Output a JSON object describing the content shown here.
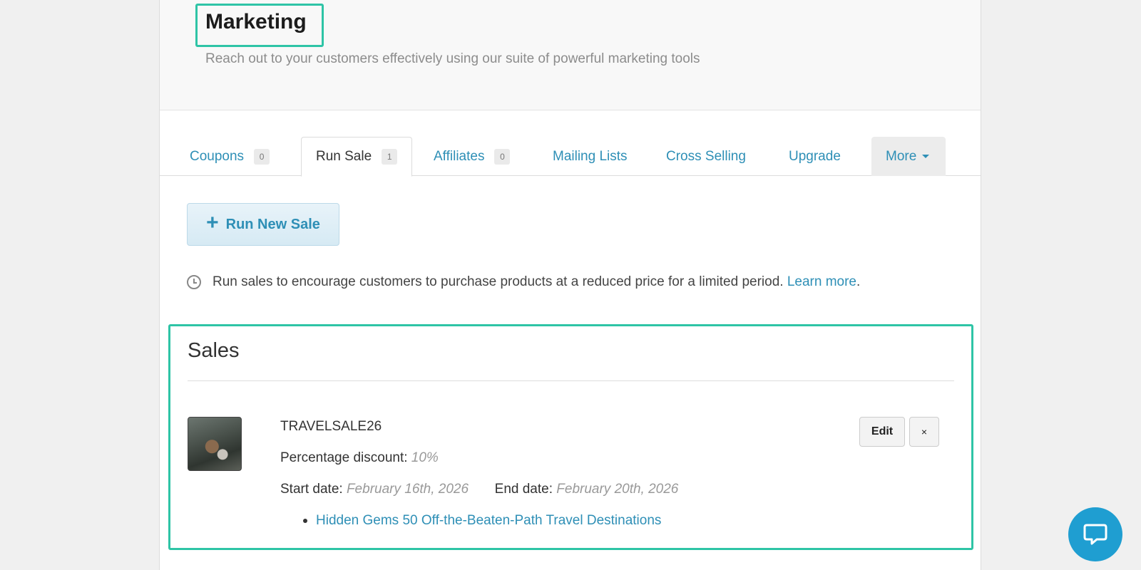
{
  "header": {
    "title": "Marketing",
    "subtitle": "Reach out to your customers effectively using our suite of powerful marketing tools"
  },
  "tabs": [
    {
      "label": "Coupons",
      "count": "0"
    },
    {
      "label": "Run Sale",
      "count": "1",
      "active": true
    },
    {
      "label": "Affiliates",
      "count": "0"
    },
    {
      "label": "Mailing Lists"
    },
    {
      "label": "Cross Selling"
    },
    {
      "label": "Upgrade"
    },
    {
      "label": "More"
    }
  ],
  "run_button": {
    "icon": "plus-icon",
    "label": "Run New Sale"
  },
  "info": {
    "text": "Run sales to encourage customers to purchase products at a reduced price for a limited period.",
    "link": "Learn more",
    "suffix": "."
  },
  "sales": {
    "title": "Sales",
    "items": [
      {
        "name": "TRAVELSALE26",
        "discount_label": "Percentage discount:",
        "discount_value": "10%",
        "start_label": "Start date:",
        "start_value": "February 16th, 2026",
        "end_label": "End date:",
        "end_value": "February 20th, 2026",
        "product": "Hidden Gems 50 Off-the-Beaten-Path Travel Destinations",
        "edit_label": "Edit",
        "delete_label": "×"
      }
    ]
  },
  "colors": {
    "accent": "#2e8fb6",
    "highlight": "#2ec4a6",
    "chat": "#1f9ed1"
  }
}
